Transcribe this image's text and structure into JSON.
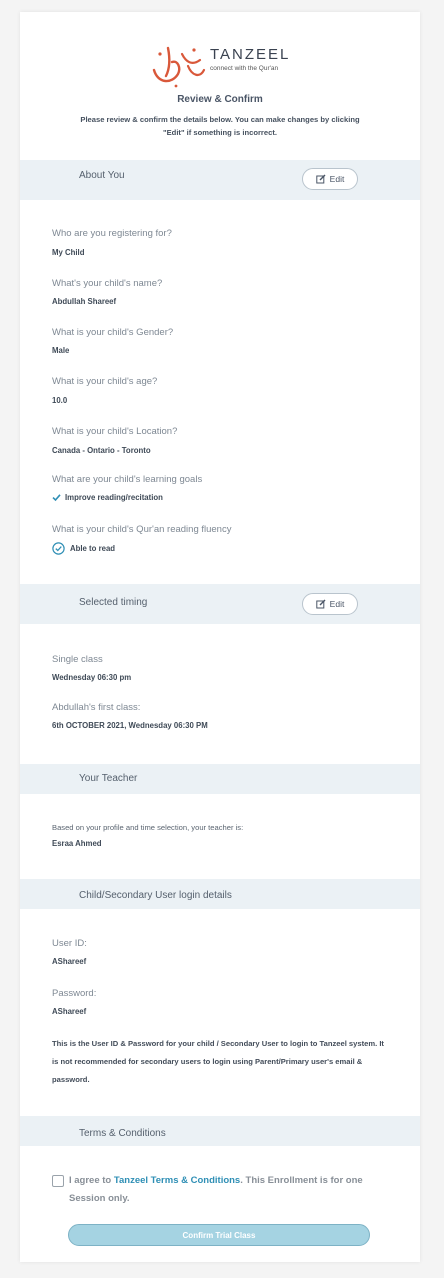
{
  "brand": {
    "name": "TANZEEL",
    "tagline": "connect with the Qur'an",
    "accent": "#d9583a"
  },
  "header": {
    "title": "Review & Confirm",
    "intro": "Please review & confirm the details below. You can make changes by clicking \"Edit\" if something is incorrect."
  },
  "sections": {
    "about": {
      "label": "About You",
      "edit": "Edit"
    },
    "timing": {
      "label": "Selected timing",
      "edit": "Edit"
    },
    "teacher": {
      "label": "Your Teacher"
    },
    "login": {
      "label": "Child/Secondary User login details"
    },
    "terms": {
      "label": "Terms & Conditions"
    }
  },
  "about": {
    "q1": "Who are you registering for?",
    "a1": "My Child",
    "q2": "What's your child's name?",
    "a2": "Abdullah Shareef",
    "q3": "What is your child's Gender?",
    "a3": "Male",
    "q4": "What is your child's age?",
    "a4": "10.0",
    "q5": "What is your child's Location?",
    "a5": "Canada - Ontario - Toronto",
    "q6": "What are your child's learning goals",
    "a6": "Improve reading/recitation",
    "q7": "What is your child's Qur'an reading fluency",
    "a7": "Able to read"
  },
  "timing": {
    "q1": "Single class",
    "a1": "Wednesday 06:30 pm",
    "q2": "Abdullah's first class:",
    "a2": "6th OCTOBER 2021, Wednesday 06:30 PM"
  },
  "teacher": {
    "intro": "Based on your profile and time selection, your teacher is:",
    "name": "Esraa Ahmed"
  },
  "login": {
    "user_label": "User ID:",
    "user_value": "AShareef",
    "pass_label": "Password:",
    "pass_value": "AShareef",
    "note": "This is the User ID & Password for your child / Secondary User to login to Tanzeel system. It is not recommended for secondary users to login using Parent/Primary user's email & password."
  },
  "terms": {
    "prefix": "I agree to",
    "link": "Tanzeel Terms & Conditions",
    "suffix": ". This Enrollment is for one Session only.",
    "button": "Confirm Trial Class"
  },
  "icons": {
    "edit": "edit-icon",
    "check": "check-icon",
    "circle_check": "circle-check-icon",
    "checkbox": "checkbox-icon"
  }
}
